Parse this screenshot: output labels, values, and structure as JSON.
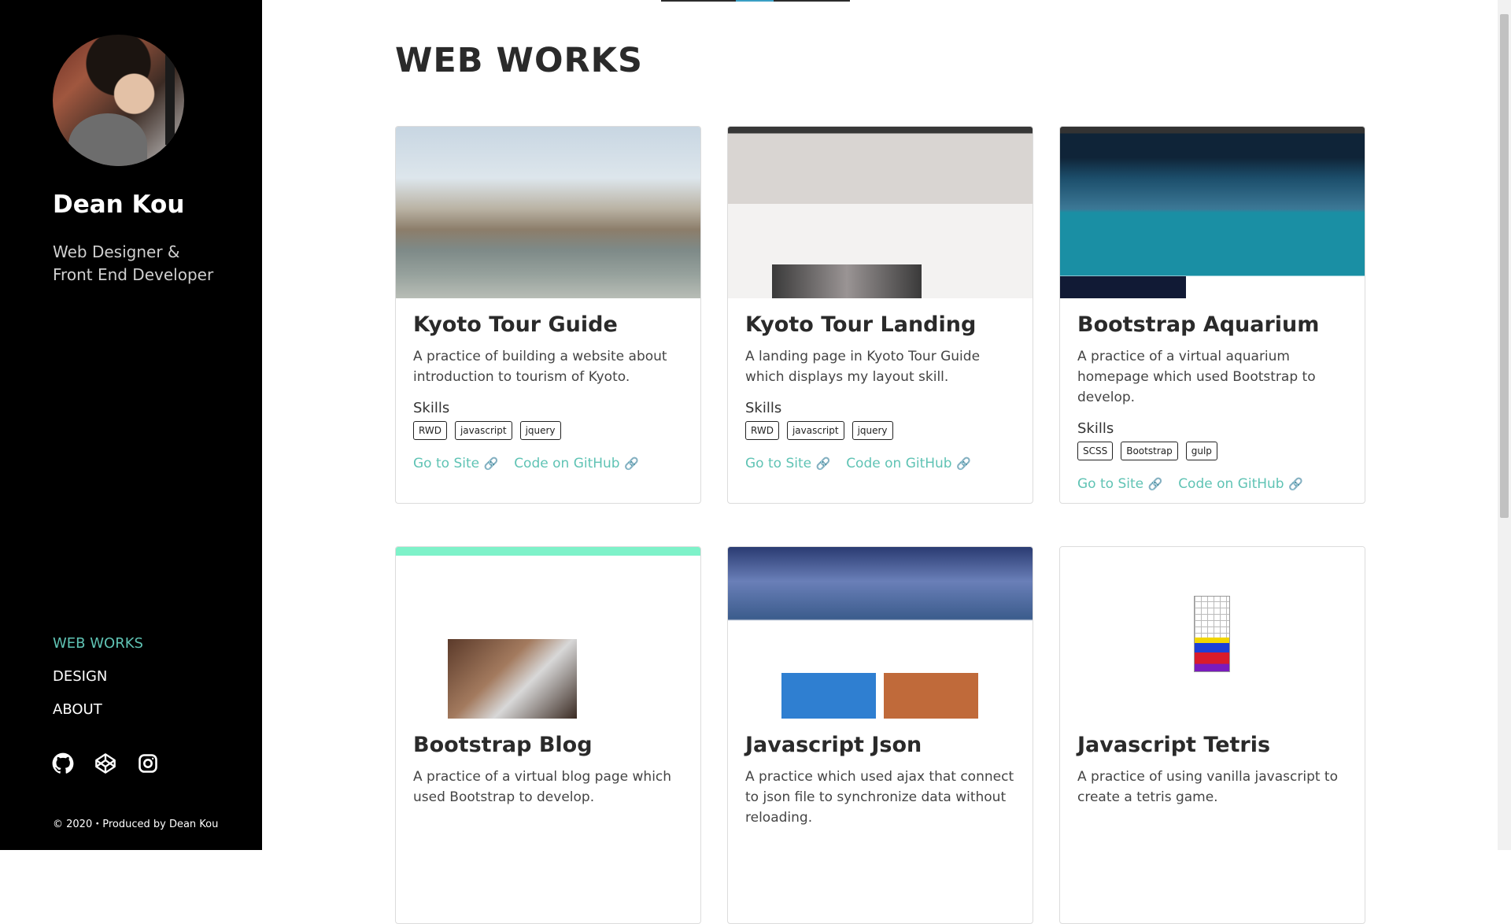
{
  "sidebar": {
    "name": "Dean Kou",
    "role_line1": "Web Designer &",
    "role_line2": "Front End Developer",
    "nav": [
      {
        "label": "WEB WORKS"
      },
      {
        "label": "DESIGN"
      },
      {
        "label": "ABOUT"
      }
    ],
    "social_icons": [
      "github-icon",
      "codepen-icon",
      "instagram-icon"
    ],
    "footer": "© 2020・Produced by Dean Kou"
  },
  "main": {
    "title": "WEB WORKS",
    "skills_label": "Skills",
    "link_site": "Go to Site",
    "link_code": "Code on GitHub",
    "cards": [
      {
        "title": "Kyoto Tour Guide",
        "desc": "A practice of building a website about introduction to tourism of Kyoto.",
        "tags": [
          "RWD",
          "javascript",
          "jquery"
        ]
      },
      {
        "title": "Kyoto Tour Landing",
        "desc": "A landing page in Kyoto Tour Guide which displays my layout skill.",
        "tags": [
          "RWD",
          "javascript",
          "jquery"
        ]
      },
      {
        "title": "Bootstrap Aquarium",
        "desc": "A practice of a virtual aquarium homepage which used Bootstrap to develop.",
        "tags": [
          "SCSS",
          "Bootstrap",
          "gulp"
        ]
      },
      {
        "title": "Bootstrap Blog",
        "desc": "A practice of a virtual blog page which used Bootstrap to develop."
      },
      {
        "title": "Javascript Json",
        "desc": "A practice which used ajax that connect to json file to synchronize data without reloading."
      },
      {
        "title": "Javascript Tetris",
        "desc": "A practice of using vanilla javascript to create a tetris game."
      }
    ]
  },
  "colors": {
    "accent": "#5fc3b4",
    "sidebar_bg": "#000000"
  }
}
